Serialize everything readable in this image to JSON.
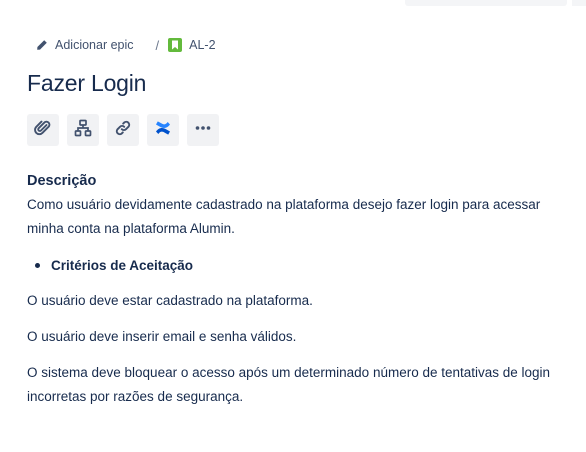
{
  "breadcrumb": {
    "add_epic_label": "Adicionar epic",
    "separator": "/",
    "issue_key": "AL-2"
  },
  "issue": {
    "title": "Fazer Login"
  },
  "toolbar": {
    "icons": [
      "attachment-icon",
      "child-issues-icon",
      "link-icon",
      "confluence-icon",
      "more-icon"
    ]
  },
  "description": {
    "heading": "Descrição",
    "intro": "Como usuário devidamente cadastrado na plataforma desejo fazer login para acessar minha conta na plataforma Alumin.",
    "bullet": "Critérios de Aceitação",
    "criteria": [
      "O usuário deve estar cadastrado na plataforma.",
      "O usuário deve inserir email e senha válidos.",
      "O sistema deve bloquear o acesso após um determinado número de tentativas de login incorretas por razões de segurança."
    ]
  },
  "colors": {
    "text": "#172b4d",
    "secondary_text": "#42526e",
    "story_green": "#63ba3c",
    "confluence_blue": "#0052cc",
    "button_bg": "#f1f2f4"
  }
}
